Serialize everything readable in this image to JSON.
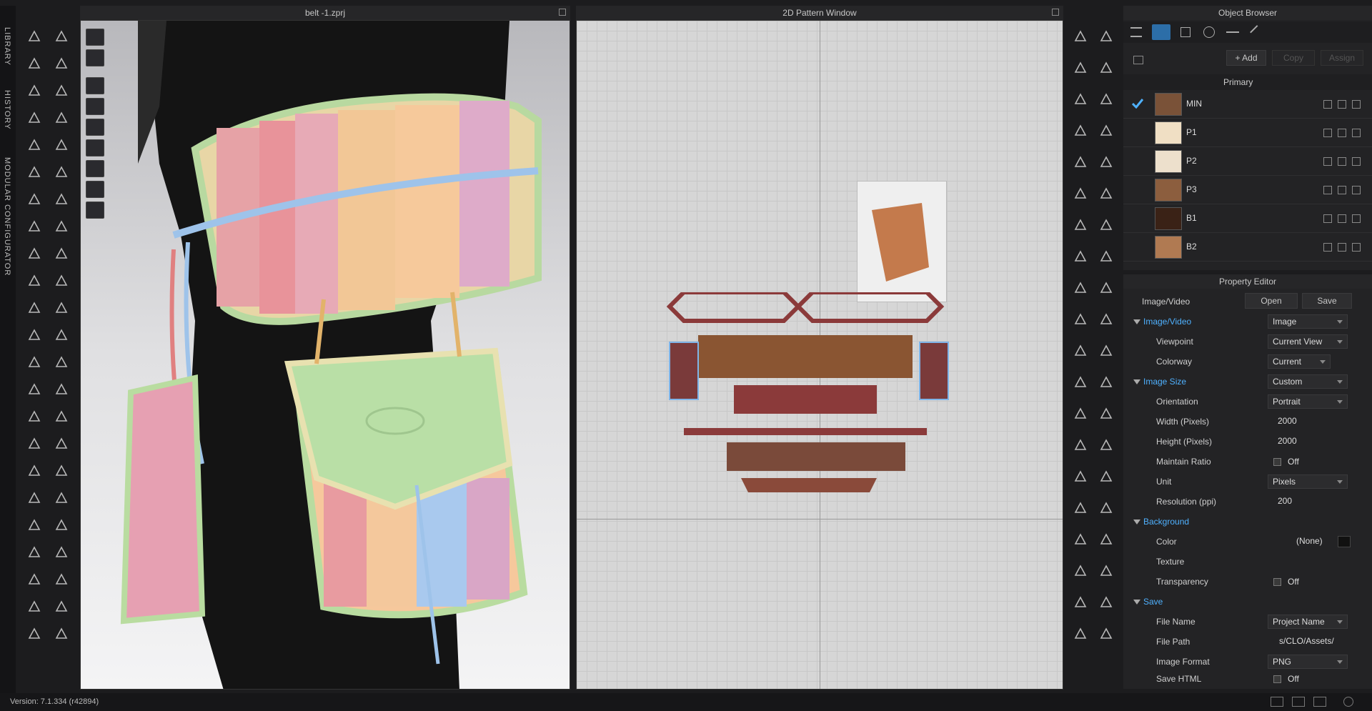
{
  "sidebar": {
    "tabs": [
      "LIBRARY",
      "HISTORY",
      "MODULAR CONFIGURATOR"
    ]
  },
  "view3d": {
    "title": "belt -1.zprj"
  },
  "pattern": {
    "title": "2D Pattern Window"
  },
  "object_browser": {
    "title": "Object Browser",
    "add_label": "+ Add",
    "copy_label": "Copy",
    "assign_label": "Assign",
    "colorway": "Primary",
    "materials": [
      {
        "name": "MIN",
        "color": "#7a5238",
        "checked": true
      },
      {
        "name": "P1",
        "color": "#f0dfc4",
        "checked": false
      },
      {
        "name": "P2",
        "color": "#ede0cc",
        "checked": false
      },
      {
        "name": "P3",
        "color": "#8c5e3e",
        "checked": false
      },
      {
        "name": "B1",
        "color": "#3a2216",
        "checked": false
      },
      {
        "name": "B2",
        "color": "#b07a52",
        "checked": false
      }
    ]
  },
  "property_editor": {
    "title": "Property Editor",
    "header_label": "Image/Video",
    "open_label": "Open",
    "save_label": "Save",
    "sections": {
      "image_video": {
        "label": "Image/Video",
        "value": "Image",
        "viewpoint_label": "Viewpoint",
        "viewpoint": "Current View",
        "colorway_label": "Colorway",
        "colorway": "Current"
      },
      "image_size": {
        "label": "Image Size",
        "value": "Custom",
        "orientation_label": "Orientation",
        "orientation": "Portrait",
        "width_label": "Width (Pixels)",
        "width": "2000",
        "height_label": "Height (Pixels)",
        "height": "2000",
        "ratio_label": "Maintain Ratio",
        "ratio": "Off",
        "unit_label": "Unit",
        "unit": "Pixels",
        "resolution_label": "Resolution (ppi)",
        "resolution": "200"
      },
      "background": {
        "label": "Background",
        "color_label": "Color",
        "color": "(None)",
        "texture_label": "Texture",
        "transparency_label": "Transparency",
        "transparency": "Off"
      },
      "save": {
        "label": "Save",
        "filename_label": "File Name",
        "filename": "Project Name",
        "filepath_label": "File Path",
        "filepath": "s/CLO/Assets/",
        "format_label": "Image Format",
        "format": "PNG",
        "html_label": "Save HTML",
        "html": "Off"
      }
    }
  },
  "status": {
    "version": "Version: 7.1.334 (r42894)"
  },
  "colors": {
    "accent": "#4fb1ff",
    "panel": "#232325",
    "background": "#1c1c1e"
  }
}
